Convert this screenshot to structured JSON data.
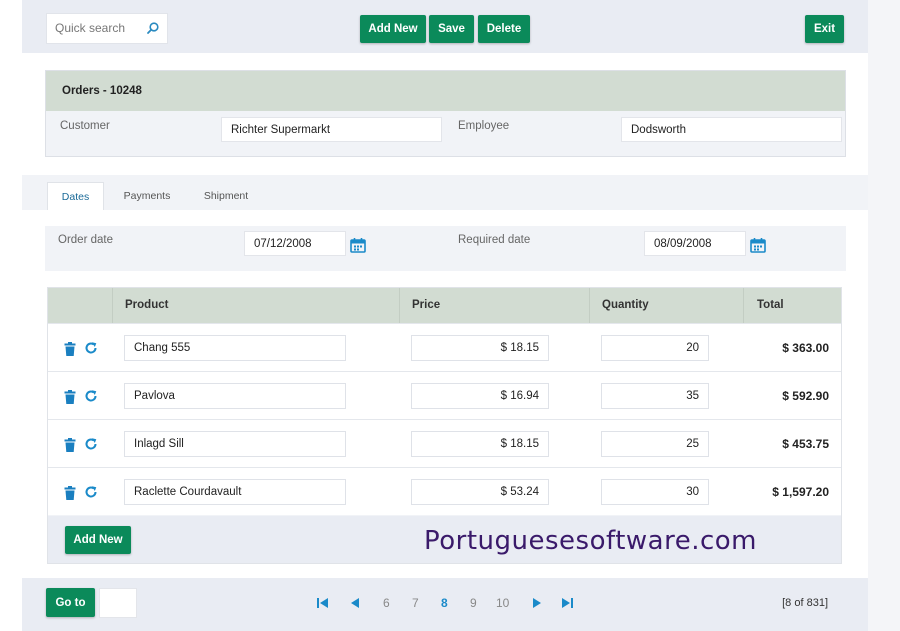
{
  "toolbar": {
    "search_placeholder": "Quick search",
    "add_new_label": "Add New",
    "save_label": "Save",
    "delete_label": "Delete",
    "exit_label": "Exit"
  },
  "order": {
    "title": "Orders - 10248",
    "customer_label": "Customer",
    "customer_value": "Richter Supermarkt",
    "employee_label": "Employee",
    "employee_value": "Dodsworth"
  },
  "tabs": [
    {
      "label": "Dates",
      "active": true
    },
    {
      "label": "Payments",
      "active": false
    },
    {
      "label": "Shipment",
      "active": false
    }
  ],
  "dates": {
    "order_date_label": "Order date",
    "order_date_value": "07/12/2008",
    "required_date_label": "Required date",
    "required_date_value": "08/09/2008"
  },
  "grid": {
    "headers": {
      "product": "Product",
      "price": "Price",
      "quantity": "Quantity",
      "total": "Total"
    },
    "rows": [
      {
        "product": "Chang 555",
        "price": "$ 18.15",
        "quantity": "20",
        "total": "$ 363.00"
      },
      {
        "product": "Pavlova",
        "price": "$ 16.94",
        "quantity": "35",
        "total": "$ 592.90"
      },
      {
        "product": "Inlagd Sill",
        "price": "$ 18.15",
        "quantity": "25",
        "total": "$ 453.75"
      },
      {
        "product": "Raclette Courdavault",
        "price": "$ 53.24",
        "quantity": "30",
        "total": "$ 1,597.20"
      }
    ],
    "add_new_label": "Add New"
  },
  "watermark": "Portuguesesoftware.com",
  "pagination": {
    "goto_label": "Go to",
    "pages": [
      "6",
      "7",
      "8",
      "9",
      "10"
    ],
    "current_page": "8",
    "info": "[8 of 831]"
  },
  "colors": {
    "accent_green": "#0b8a5a",
    "header_green": "#d2dcd2",
    "active_link_blue": "#1a8ac9"
  }
}
